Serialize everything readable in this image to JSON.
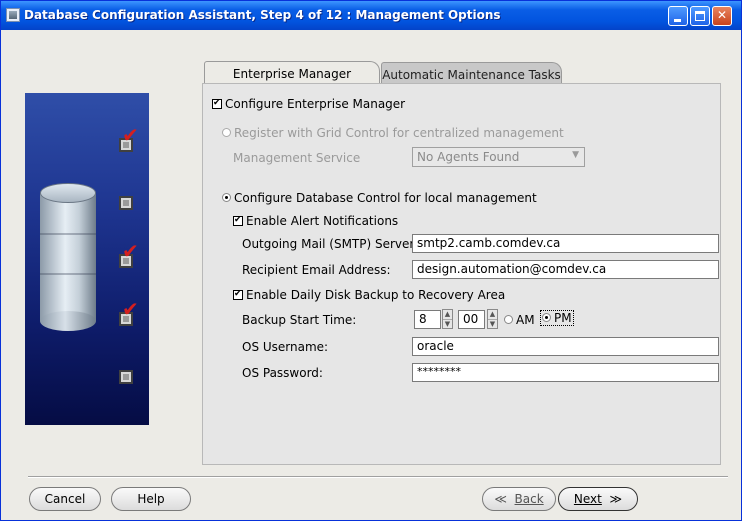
{
  "window": {
    "title": "Database Configuration Assistant, Step 4 of 12 : Management Options",
    "controls": [
      "minimize",
      "maximize",
      "close"
    ]
  },
  "wizard": {
    "steps_checked": [
      true,
      false,
      true,
      true,
      false
    ],
    "tabs": [
      {
        "label": "Enterprise Manager",
        "active": true
      },
      {
        "label": "Automatic Maintenance Tasks",
        "active": false
      }
    ]
  },
  "form": {
    "configure_em": {
      "label": "Configure Enterprise Manager",
      "checked": true
    },
    "grid_control": {
      "label": "Register with Grid Control for centralized management",
      "selected": false,
      "enabled": false
    },
    "mgmt_service": {
      "label": "Management Service",
      "value": "No Agents Found"
    },
    "db_control": {
      "label": "Configure Database Control for local management",
      "selected": true
    },
    "alerts": {
      "label": "Enable Alert Notifications",
      "checked": true
    },
    "smtp": {
      "label": "Outgoing Mail (SMTP) Server:",
      "value": "smtp2.camb.comdev.ca"
    },
    "email": {
      "label": "Recipient Email Address:",
      "value": "design.automation@comdev.ca"
    },
    "backup": {
      "label": "Enable Daily Disk Backup to Recovery Area",
      "checked": true
    },
    "backup_time": {
      "label": "Backup Start Time:",
      "hour": "8",
      "minute": "00",
      "am_label": "AM",
      "pm_label": "PM",
      "selected": "PM"
    },
    "os_user": {
      "label": "OS Username:",
      "value": "oracle"
    },
    "os_password": {
      "label": "OS Password:",
      "value": "********"
    }
  },
  "buttons": {
    "cancel": "Cancel",
    "help": "Help",
    "back": "Back",
    "next": "Next"
  },
  "colors": {
    "titlebar": "#0254df",
    "check_mark": "#d41f1f",
    "side_panel": "#1e3590"
  }
}
